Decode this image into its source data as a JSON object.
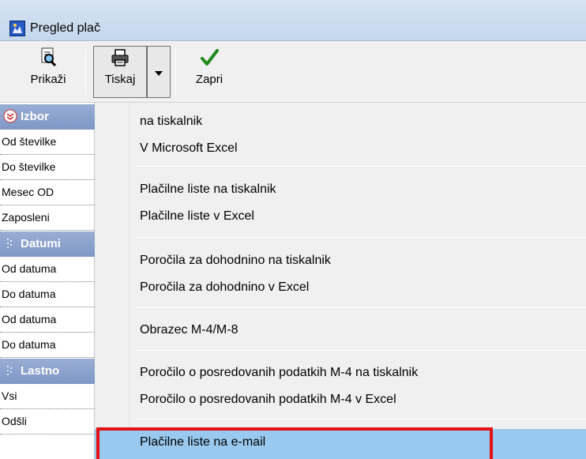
{
  "window": {
    "title": "Pregled plač"
  },
  "toolbar": {
    "prikazi_label": "Prikaži",
    "tiskaj_label": "Tiskaj",
    "zapri_label": "Zapri"
  },
  "left_panel": {
    "izbor_header": "Izbor",
    "od_stevilke": "Od številke",
    "do_stevilke": "Do številke",
    "mesec_od": "Mesec OD",
    "zaposleni": "Zaposleni",
    "datumi_header": "Datumi",
    "od_datuma_1": "Od datuma",
    "do_datuma_1": "Do datuma",
    "od_datuma_2": "Od datuma",
    "do_datuma_2": "Do datuma",
    "lastno_header": "Lastno",
    "vsi": "Vsi",
    "odsli": "Odšli"
  },
  "menu": {
    "items": [
      "na tiskalnik",
      "V Microsoft Excel",
      "Plačilne liste na tiskalnik",
      "Plačilne liste v Excel",
      "Poročila za dohodnino na tiskalnik",
      "Poročila za dohodnino v Excel",
      "Obrazec M-4/M-8",
      "Poročilo o posredovanih podatkih M-4 na tiskalnik",
      "Poročilo o posredovanih podatkih M-4 v Excel",
      "Plačilne liste na e-mail"
    ],
    "highlighted_index": 9
  },
  "colors": {
    "highlight": "#99c9ef",
    "annotation_box": "#e01212",
    "group_header": "#8aa1cc"
  }
}
